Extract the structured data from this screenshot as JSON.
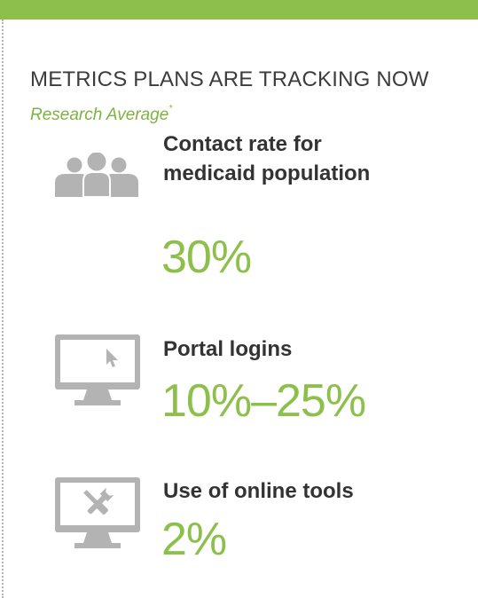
{
  "header": {
    "title": "METRICS PLANS ARE TRACKING NOW",
    "subtitle": "Research Average",
    "footnote_marker": "*"
  },
  "metrics": [
    {
      "label_line1": "Contact rate for",
      "label_line2": "medicaid population",
      "value": "30%",
      "icon": "people-group-icon"
    },
    {
      "label_line1": "Portal logins",
      "value": "10%–25%",
      "icon": "monitor-cursor-icon"
    },
    {
      "label_line1": "Use of online tools",
      "value": "2%",
      "icon": "monitor-tools-icon"
    }
  ],
  "colors": {
    "accent": "#8cc04b",
    "icon_gray": "#b3b3b3",
    "text": "#333333"
  }
}
